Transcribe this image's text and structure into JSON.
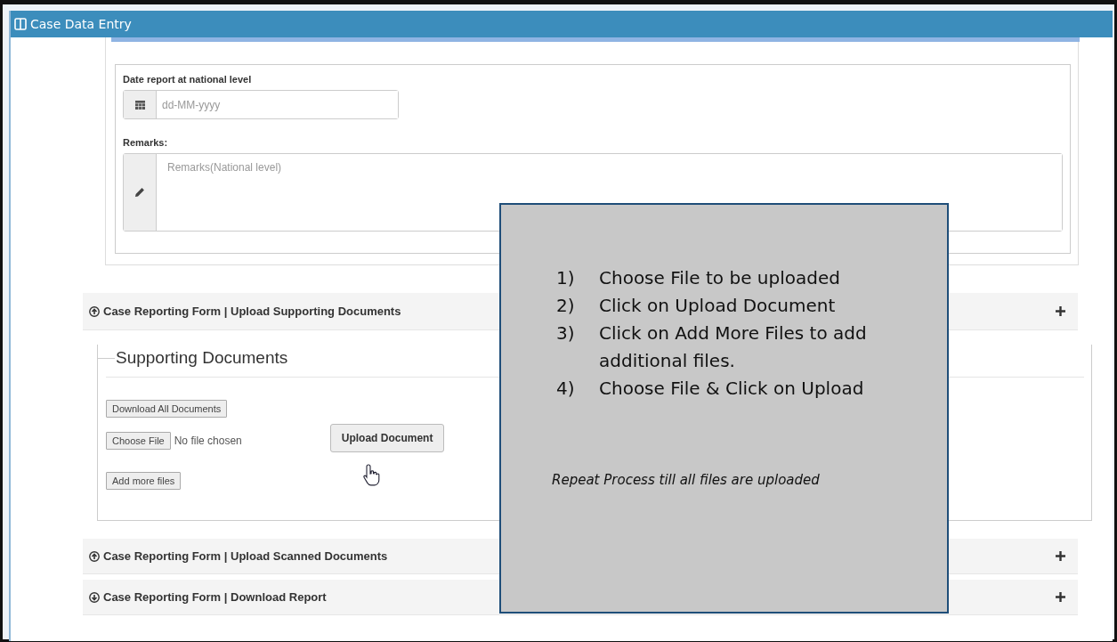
{
  "window": {
    "title": "Case Data Entry"
  },
  "national": {
    "date_label": "Date report at national level",
    "date_placeholder": "dd-MM-yyyy",
    "remarks_label": "Remarks:",
    "remarks_placeholder": "Remarks(National level)"
  },
  "sections": [
    {
      "kind": "upload",
      "title": "Case Reporting Form | Upload Supporting Documents",
      "expanded": true
    },
    {
      "kind": "upload",
      "title": "Case Reporting Form | Upload Scanned Documents",
      "expanded": false
    },
    {
      "kind": "download",
      "title": "Case Reporting Form | Download Report",
      "expanded": false
    }
  ],
  "supporting": {
    "legend": "Supporting Documents",
    "download_all": "Download All Documents",
    "choose_file": "Choose File",
    "no_file": "No file chosen",
    "upload": "Upload Document",
    "add_more": "Add more files"
  },
  "callout": {
    "steps": [
      {
        "number": "1)",
        "text": "Choose File to be uploaded"
      },
      {
        "number": "2)",
        "text": "Click on Upload Document"
      },
      {
        "number": "3)",
        "text": "Click on Add More Files to add additional files."
      },
      {
        "number": "4)",
        "text": "Choose File & Click on Upload"
      }
    ],
    "note": "Repeat Process till all files are uploaded"
  }
}
